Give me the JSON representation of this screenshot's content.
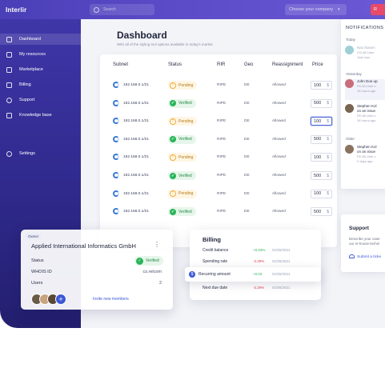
{
  "app": {
    "brand": "Interlir"
  },
  "topbar": {
    "search_placeholder": "Search",
    "company_select": "Choose your company",
    "user_chip": "R"
  },
  "sidebar": {
    "items": [
      {
        "label": "Dashboard",
        "icon": "grid-icon",
        "active": true
      },
      {
        "label": "My resources",
        "icon": "server-icon",
        "active": false
      },
      {
        "label": "Marketplace",
        "icon": "cart-icon",
        "active": false
      },
      {
        "label": "Billing",
        "icon": "card-icon",
        "active": false
      },
      {
        "label": "Support",
        "icon": "lifebuoy-icon",
        "active": false
      },
      {
        "label": "Knowledge base",
        "icon": "graduation-cap-icon",
        "active": false
      },
      {
        "label": "Settings",
        "icon": "gear-icon",
        "active": false
      }
    ]
  },
  "page": {
    "title": "Dashboard",
    "subtitle": "With all of the styling tool options available in today's market"
  },
  "table": {
    "headers": [
      "Subnet",
      "Status",
      "RIR",
      "Geo",
      "Reassignment",
      "Price"
    ],
    "rows": [
      {
        "subnet": "192.168.0.1/21",
        "status": "Pending",
        "rir": "RIPE",
        "geo": "DE",
        "reassignment": "Allowed",
        "price": "100",
        "currency": "$"
      },
      {
        "subnet": "192.168.0.1/21",
        "status": "Verified",
        "rir": "RIPE",
        "geo": "DE",
        "reassignment": "Allowed",
        "price": "500",
        "currency": "$"
      },
      {
        "subnet": "192.168.0.1/21",
        "status": "Pending",
        "rir": "RIPE",
        "geo": "DE",
        "reassignment": "Allowed",
        "price": "100",
        "currency": "$"
      },
      {
        "subnet": "192.168.0.1/21",
        "status": "Verified",
        "rir": "RIPE",
        "geo": "DE",
        "reassignment": "Allowed",
        "price": "500",
        "currency": "$"
      },
      {
        "subnet": "192.168.0.1/21",
        "status": "Pending",
        "rir": "RIPE",
        "geo": "DE",
        "reassignment": "Allowed",
        "price": "100",
        "currency": "$"
      },
      {
        "subnet": "192.168.0.1/21",
        "status": "Verified",
        "rir": "RIPE",
        "geo": "DE",
        "reassignment": "Allowed",
        "price": "500",
        "currency": "$"
      },
      {
        "subnet": "192.168.0.1/21",
        "status": "Pending",
        "rir": "RIPE",
        "geo": "DE",
        "reassignment": "Allowed",
        "price": "100",
        "currency": "$"
      },
      {
        "subnet": "192.168.0.1/21",
        "status": "Verified",
        "rir": "RIPE",
        "geo": "DE",
        "reassignment": "Allowed",
        "price": "500",
        "currency": "$"
      }
    ]
  },
  "notifications": {
    "header": "NOTIFICATIONS",
    "groups": [
      {
        "label": "Today",
        "items": [
          {
            "name": "Nas Ibasen",
            "line2": "CG-66 User",
            "time": "Just now",
            "faded": true
          }
        ]
      },
      {
        "label": "Yesterday",
        "items": [
          {
            "name": "John Doe up",
            "line2": "FK-60 User c",
            "time": "16 hours ago",
            "faded": false
          },
          {
            "name": "Stephen Kol",
            "line1b": "on an issue",
            "line2": "FE-65 User c",
            "time": "16 hours ago",
            "faded": false
          }
        ]
      },
      {
        "label": "Older",
        "items": [
          {
            "name": "Stephen Kol",
            "line1b": "on an issue",
            "line2": "FE-65 User c",
            "time": "2 days ago",
            "faded": false
          }
        ]
      }
    ]
  },
  "support": {
    "title": "Support",
    "desc1": "Describe your case",
    "desc2": "our in-house techni",
    "link": "Submit a ticke"
  },
  "owner": {
    "tag": "Owner",
    "company": "Applied International Informatics GmbH",
    "status_label": "Status",
    "status_value": "Verified",
    "whois_label": "WHOIS ID",
    "whois_value": "cs.relcom",
    "users_label": "Users",
    "users_value": "2",
    "invite": "Invite new members"
  },
  "billing": {
    "title": "Billing",
    "rows": [
      {
        "label": "Credit balance",
        "change": "+0.03%",
        "dir": "up",
        "date": "01/06/2021"
      },
      {
        "label": "Spending rate",
        "change": "-3.29%",
        "dir": "down",
        "date": "01/06/2021"
      },
      {
        "label": "Recurring amount",
        "change": "+0.03",
        "dir": "up",
        "date": "01/06/2021"
      },
      {
        "label": "Next due date",
        "change": "-3.29%",
        "dir": "down",
        "date": "01/06/2021"
      }
    ]
  },
  "colors": {
    "brand": "#4a3fb6",
    "verified": "#2ab45a",
    "pending": "#f3a930",
    "negative": "#e0414f",
    "link": "#3d59d6"
  }
}
